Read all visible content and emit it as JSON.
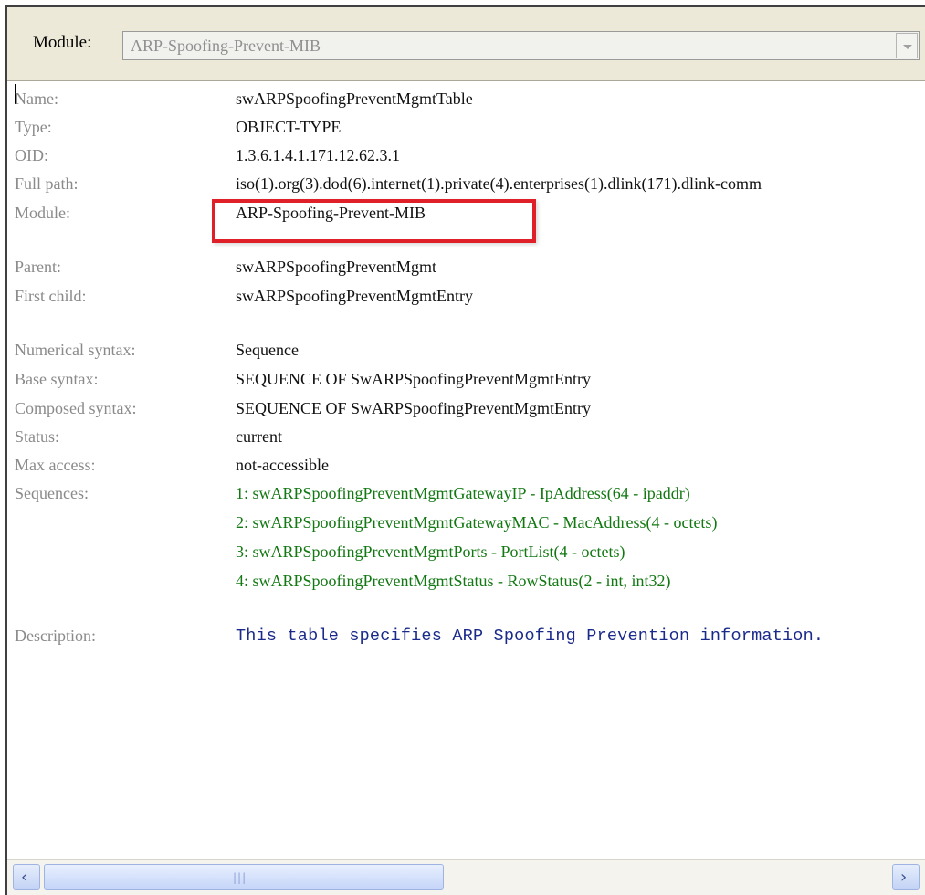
{
  "toolbar": {
    "module_label": "Module:",
    "module_value": "ARP-Spoofing-Prevent-MIB"
  },
  "details": {
    "name_label": "Name:",
    "name_value": "swARPSpoofingPreventMgmtTable",
    "type_label": "Type:",
    "type_value": "OBJECT-TYPE",
    "oid_label": "OID:",
    "oid_value": "1.3.6.1.4.1.171.12.62.3.1",
    "fullpath_label": "Full path:",
    "fullpath_value": "iso(1).org(3).dod(6).internet(1).private(4).enterprises(1).dlink(171).dlink-comm",
    "module_label": "Module:",
    "module_value": "ARP-Spoofing-Prevent-MIB",
    "parent_label": "Parent:",
    "parent_value": "swARPSpoofingPreventMgmt",
    "firstchild_label": "First child:",
    "firstchild_value": "swARPSpoofingPreventMgmtEntry",
    "numsyntax_label": "Numerical syntax:",
    "numsyntax_value": "Sequence",
    "basesyntax_label": "Base syntax:",
    "basesyntax_value": "SEQUENCE OF SwARPSpoofingPreventMgmtEntry",
    "compsyntax_label": "Composed syntax:",
    "compsyntax_value": "SEQUENCE OF SwARPSpoofingPreventMgmtEntry",
    "status_label": "Status:",
    "status_value": "current",
    "maxaccess_label": "Max access:",
    "maxaccess_value": "not-accessible",
    "sequences_label": "Sequences:",
    "sequences": [
      "1: swARPSpoofingPreventMgmtGatewayIP - IpAddress(64 - ipaddr)",
      "2: swARPSpoofingPreventMgmtGatewayMAC - MacAddress(4 - octets)",
      "3: swARPSpoofingPreventMgmtPorts - PortList(4 - octets)",
      "4: swARPSpoofingPreventMgmtStatus - RowStatus(2 - int, int32)"
    ],
    "description_label": "Description:",
    "description_value": "This table specifies ARP Spoofing Prevention information."
  },
  "colors": {
    "label": "#8a8a8a",
    "sequence": "#127812",
    "description": "#1a2a8a",
    "highlight": "#e02028"
  }
}
